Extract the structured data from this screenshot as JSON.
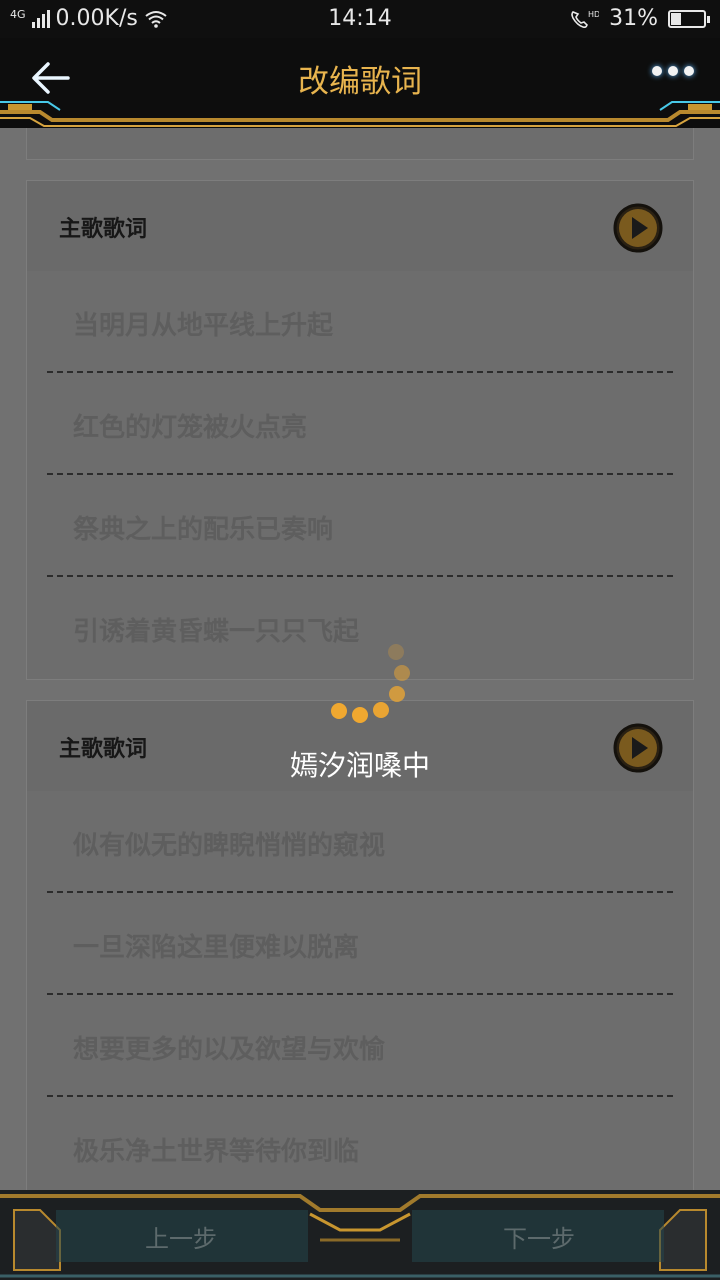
{
  "status_bar": {
    "network_type": "4G",
    "speed": "0.00K/s",
    "time": "14:14",
    "hd_badge": "HD",
    "battery_percent": "31%",
    "battery_level": 0.31
  },
  "header": {
    "title": "改编歌词",
    "back_icon": "arrow-left-icon",
    "more_icon": "more-dots-icon",
    "accent_color": "#e8b44e"
  },
  "sections": [
    {
      "title": "主歌歌词",
      "lines": [
        "当明月从地平线上升起",
        "红色的灯笼被火点亮",
        "祭典之上的配乐已奏响",
        "引诱着黄昏蝶一只只飞起"
      ]
    },
    {
      "title": "主歌歌词",
      "lines": [
        "似有似无的睥睨悄悄的窥视",
        "一旦深陷这里便难以脱离",
        "想要更多的以及欲望与欢愉",
        "极乐净土世界等待你到临"
      ]
    }
  ],
  "loading": {
    "text": "嫣汐润嗓中",
    "color": "#f0a830"
  },
  "footer": {
    "prev_label": "上一步",
    "next_label": "下一步"
  }
}
